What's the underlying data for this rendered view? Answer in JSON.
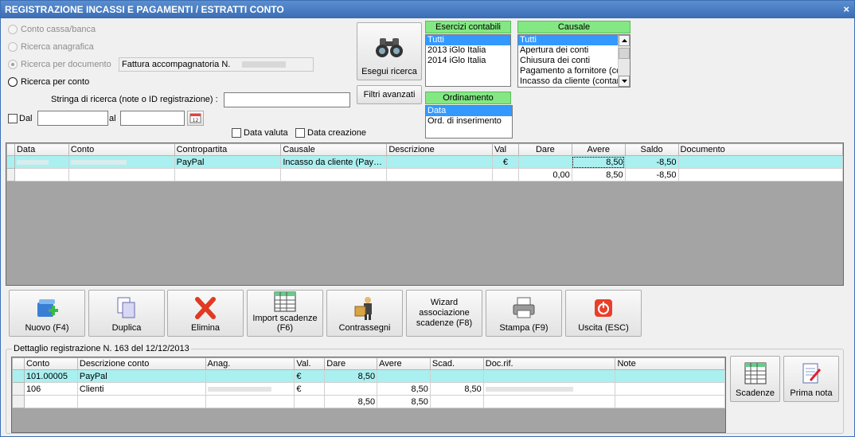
{
  "window": {
    "title": "REGISTRAZIONE INCASSI E PAGAMENTI / ESTRATTI CONTO",
    "close_glyph": "×"
  },
  "search_mode": {
    "options": [
      {
        "label": "Conto cassa/banca",
        "enabled": false,
        "checked": false
      },
      {
        "label": "Ricerca anagrafica",
        "enabled": false,
        "checked": false
      },
      {
        "label": "Ricerca per documento",
        "enabled": false,
        "checked": true
      },
      {
        "label": "Ricerca per conto",
        "enabled": true,
        "checked": false
      }
    ],
    "document_value": "Fattura accompagnatoria N."
  },
  "search_string": {
    "label": "Stringa di ricerca (note o ID registrazione) :",
    "value": ""
  },
  "date_range": {
    "from_label": "Dal",
    "from_value": "",
    "to_label": "al",
    "to_value": ""
  },
  "date_checks": {
    "valuta_label": "Data valuta",
    "creazione_label": "Data creazione"
  },
  "buttons": {
    "search": "Esegui ricerca",
    "advanced_filters": "Filtri avanzati"
  },
  "esercizi": {
    "header": "Esercizi contabili",
    "items": [
      "Tutti",
      "2013 iGlo Italia",
      "2014 iGlo Italia"
    ],
    "selected": 0
  },
  "causale": {
    "header": "Causale",
    "items": [
      "Tutti",
      "Apertura dei conti",
      "Chiusura dei conti",
      "Pagamento a fornitore (con",
      "Incasso da cliente (contan"
    ],
    "selected": 0
  },
  "ordinamento": {
    "header": "Ordinamento",
    "items": [
      "Data",
      "Ord. di inserimento"
    ],
    "selected": 0
  },
  "main_grid": {
    "columns": [
      "Data",
      "Conto",
      "Contropartita",
      "Causale",
      "Descrizione",
      "Val",
      "Dare",
      "Avere",
      "Saldo",
      "Documento"
    ],
    "rows": [
      {
        "data": "",
        "conto": "",
        "contropartita": "PayPal",
        "causale": "Incasso da cliente (Pay…",
        "descrizione": "",
        "val": "€",
        "dare": "",
        "avere": "8,50",
        "saldo": "-8,50",
        "documento": ""
      }
    ],
    "totals": {
      "dare": "0,00",
      "avere": "8,50",
      "saldo": "-8,50"
    }
  },
  "toolbar": [
    {
      "label": "Nuovo (F4)",
      "icon": "new-record-icon"
    },
    {
      "label": "Duplica",
      "icon": "duplicate-icon"
    },
    {
      "label": "Elimina",
      "icon": "delete-x-icon"
    },
    {
      "label": "Import scadenze (F6)",
      "icon": "import-spreadsheet-icon"
    },
    {
      "label": "Contrassegni",
      "icon": "courier-package-icon"
    },
    {
      "label": "Wizard associazione scadenze (F8)",
      "icon": ""
    },
    {
      "label": "Stampa (F9)",
      "icon": "printer-icon"
    },
    {
      "label": "Uscita (ESC)",
      "icon": "power-icon"
    }
  ],
  "detail": {
    "legend": "Dettaglio registrazione N. 163 del 12/12/2013",
    "columns": [
      "Conto",
      "Descrizione conto",
      "Anag.",
      "Val.",
      "Dare",
      "Avere",
      "Scad.",
      "Doc.rif.",
      "Note"
    ],
    "rows": [
      {
        "conto": "101.00005",
        "descrizione": "PayPal",
        "anag": "",
        "val": "€",
        "dare": "8,50",
        "avere": "",
        "scad": "",
        "docrif": "",
        "note": ""
      },
      {
        "conto": "106",
        "descrizione": "Clienti",
        "anag": "",
        "val": "€",
        "dare": "",
        "avere": "8,50",
        "scad": "8,50",
        "docrif": "",
        "note": ""
      }
    ],
    "totals": {
      "dare": "8,50",
      "avere": "8,50"
    }
  },
  "side_buttons": [
    {
      "label": "Scadenze",
      "icon": "spreadsheet-icon"
    },
    {
      "label": "Prima nota",
      "icon": "notebook-pen-icon"
    }
  ],
  "colors": {
    "titlebar": "#3a6db4",
    "list_header": "#83e883",
    "selection": "#3399ff",
    "row_highlight": "#aaf0f0",
    "grid_background": "#a4a4a4"
  }
}
